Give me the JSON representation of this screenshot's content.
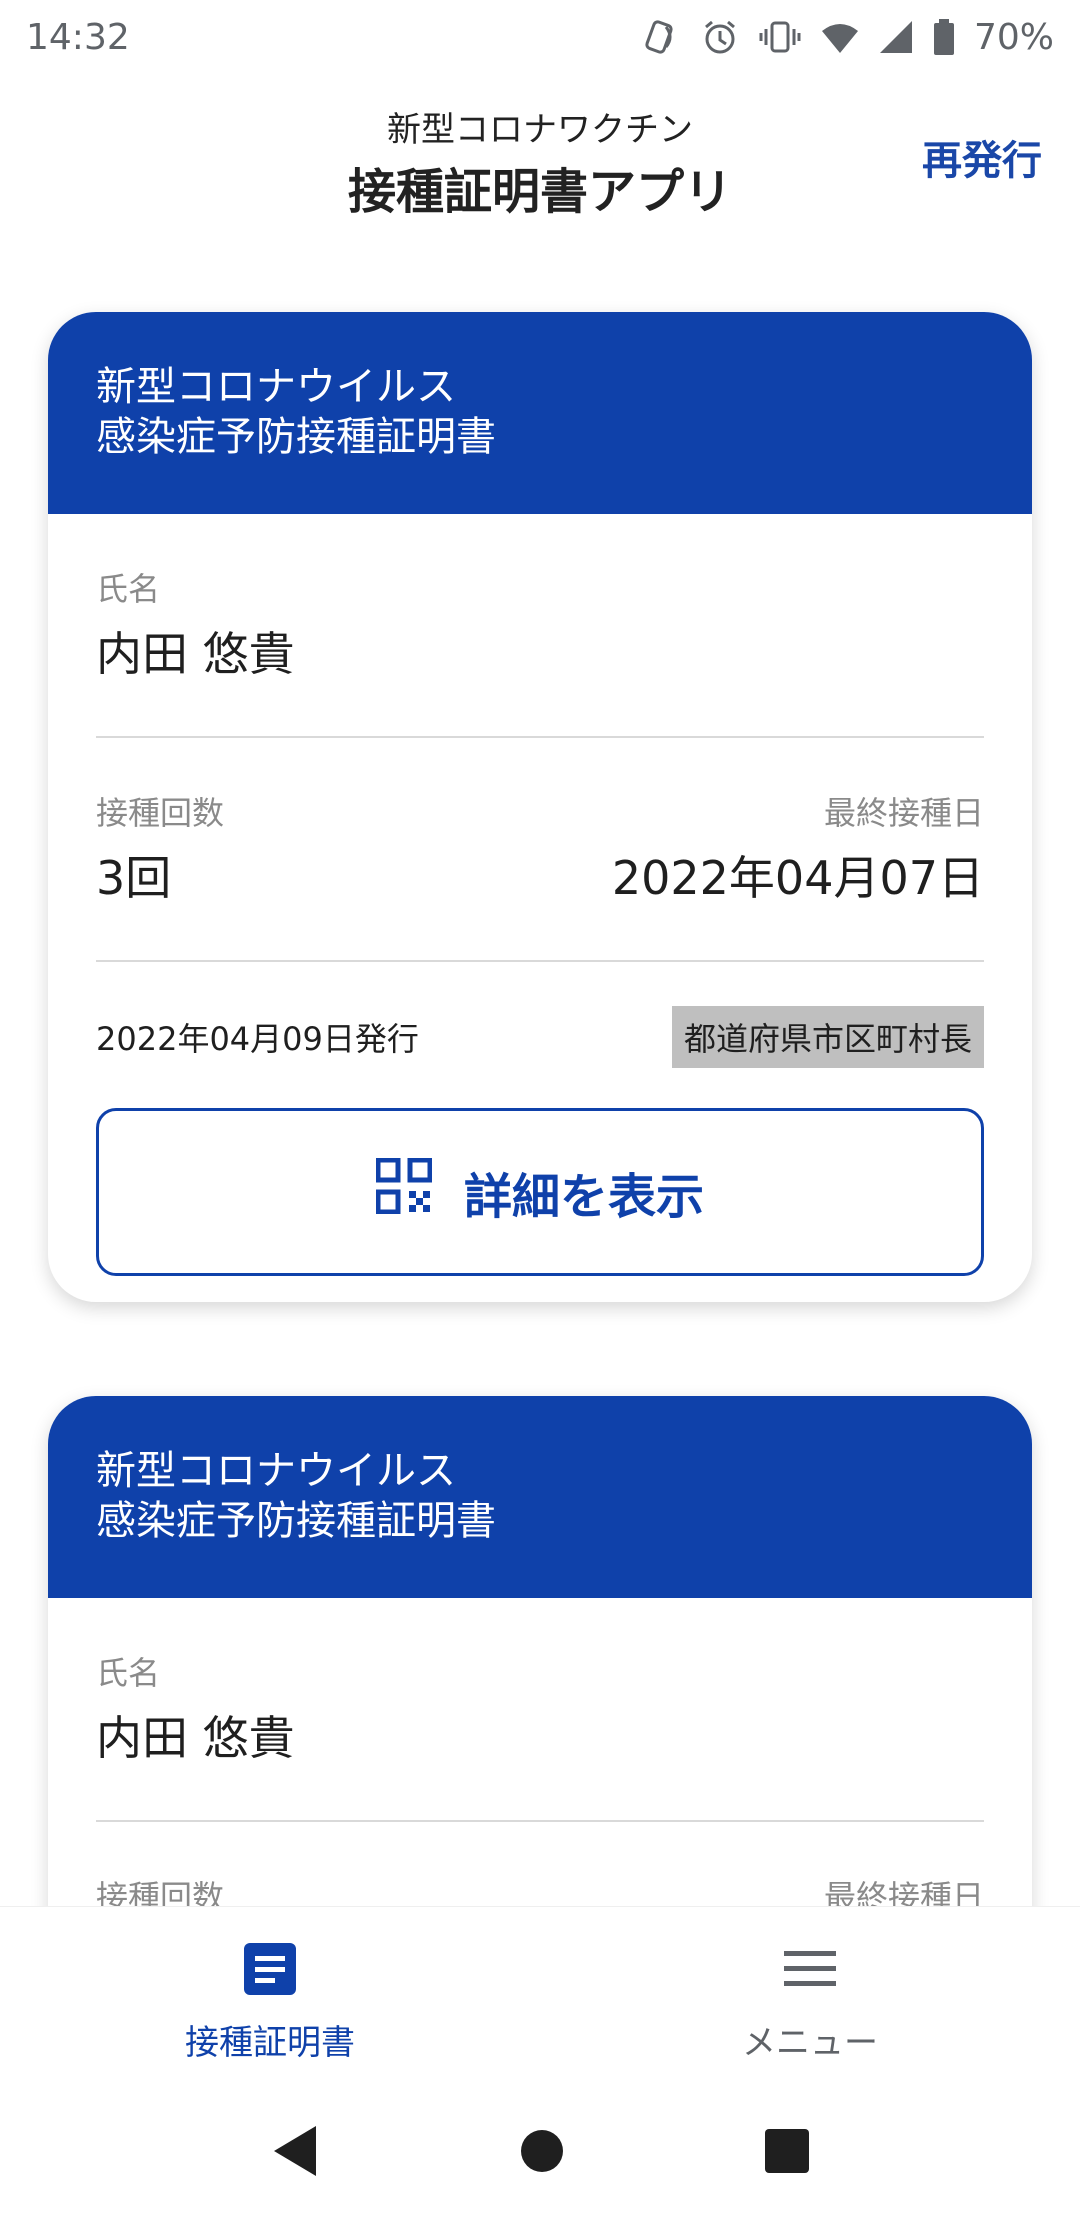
{
  "status_bar": {
    "time": "14:32",
    "battery_percent": "70%",
    "icons": [
      "nfc-icon",
      "alarm-icon",
      "vibrate-icon",
      "wifi-icon",
      "cell-signal-icon",
      "battery-icon"
    ]
  },
  "header": {
    "subtitle": "新型コロナワクチン",
    "title": "接種証明書アプリ",
    "reissue_label": "再発行"
  },
  "cards": [
    {
      "head_line1": "新型コロナウイルス",
      "head_line2": "感染症予防接種証明書",
      "name_label": "氏名",
      "name_value": "内田 悠貴",
      "dose_label": "接種回数",
      "dose_value": "3回",
      "last_date_label": "最終接種日",
      "last_date_value": "2022年04月07日",
      "issue_date": "2022年04月09日発行",
      "issuer": "都道府県市区町村長",
      "detail_label": "詳細を表示"
    },
    {
      "head_line1": "新型コロナウイルス",
      "head_line2": "感染症予防接種証明書",
      "name_label": "氏名",
      "name_value": "内田 悠貴",
      "dose_label": "接種回数",
      "last_date_label": "最終接種日"
    }
  ],
  "bottom_nav": {
    "items": [
      {
        "label": "接種証明書",
        "icon": "document-icon",
        "active": true
      },
      {
        "label": "メニュー",
        "icon": "hamburger-menu-icon",
        "active": false
      }
    ]
  },
  "colors": {
    "primary": "#0f41aa",
    "issuer_badge_bg": "#bfbfbf",
    "label_gray": "#8a8a8a"
  }
}
